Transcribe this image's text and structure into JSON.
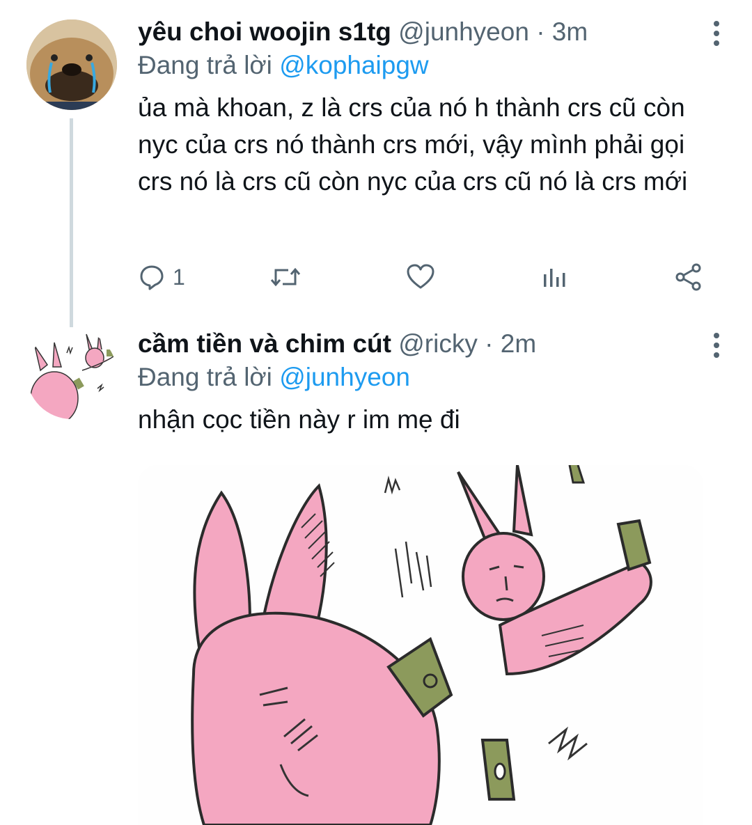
{
  "tweets": [
    {
      "display_name": "yêu choi woojin s1tg",
      "handle": "@junhyeon",
      "time": "· 3m",
      "reply_prefix": "Đang trả lời",
      "reply_to": "@kophaipgw",
      "text": "ủa mà khoan, z là crs của nó h thành crs cũ còn nyc của crs nó thành crs mới, vậy mình phải gọi crs nó là crs cũ còn nyc của crs cũ nó là crs mới",
      "actions": {
        "reply_count": "1",
        "retweet_count": "",
        "like_count": ""
      }
    },
    {
      "display_name": "cầm tiền và chim cút",
      "handle": "@ricky",
      "time": "· 2m",
      "reply_prefix": "Đang trả lời",
      "reply_to": "@junhyeon",
      "text": "nhận cọc tiền này r im mẹ đi",
      "media": "pink-bunny-money-meme"
    }
  ],
  "colors": {
    "text": "#0f1419",
    "secondary": "#536471",
    "link": "#1d9bf0",
    "thread_line": "#cfd9de",
    "bunny_pink": "#f4a7c1",
    "cash_green": "#8c9a5c"
  },
  "icons": [
    "reply-icon",
    "retweet-icon",
    "like-icon",
    "analytics-icon",
    "share-icon",
    "more-options-icon"
  ]
}
